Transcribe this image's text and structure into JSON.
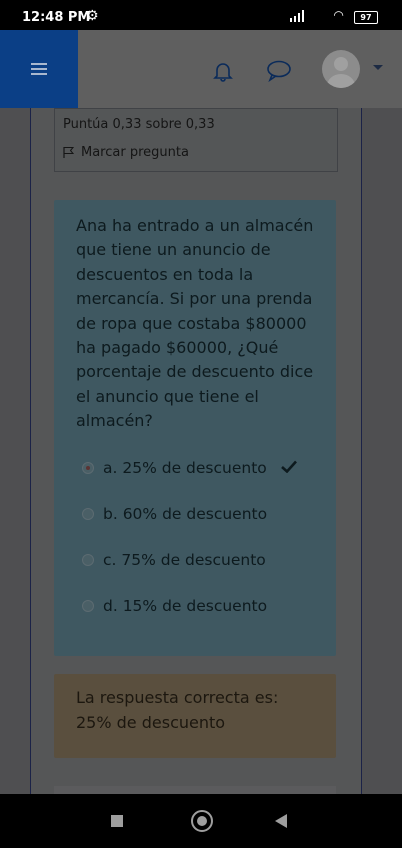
{
  "status": {
    "time": "12:48 PM",
    "battery": "97"
  },
  "info": {
    "score": "Puntúa 0,33 sobre 0,33",
    "flag_label": "Marcar pregunta"
  },
  "question": {
    "text": "Ana ha entrado a un almacén que tiene un anuncio de descuentos en toda la mercancía. Si por una prenda de ropa que costaba $80000 ha pagado $60000, ¿Qué porcentaje de descuento dice el anuncio que tiene el almacén?",
    "options": [
      {
        "label": "a. 25% de descuento",
        "selected": true,
        "correct": true
      },
      {
        "label": "b. 60% de descuento",
        "selected": false
      },
      {
        "label": "c. 75% de descuento",
        "selected": false
      },
      {
        "label": "d. 15% de descuento",
        "selected": false
      }
    ]
  },
  "feedback": {
    "text": "La respuesta correcta es: 25% de descuento"
  },
  "icons": [
    "menu-icon",
    "bell-icon",
    "chat-icon",
    "avatar-icon",
    "flag-icon",
    "check-icon",
    "recents-icon",
    "home-icon",
    "back-icon"
  ]
}
